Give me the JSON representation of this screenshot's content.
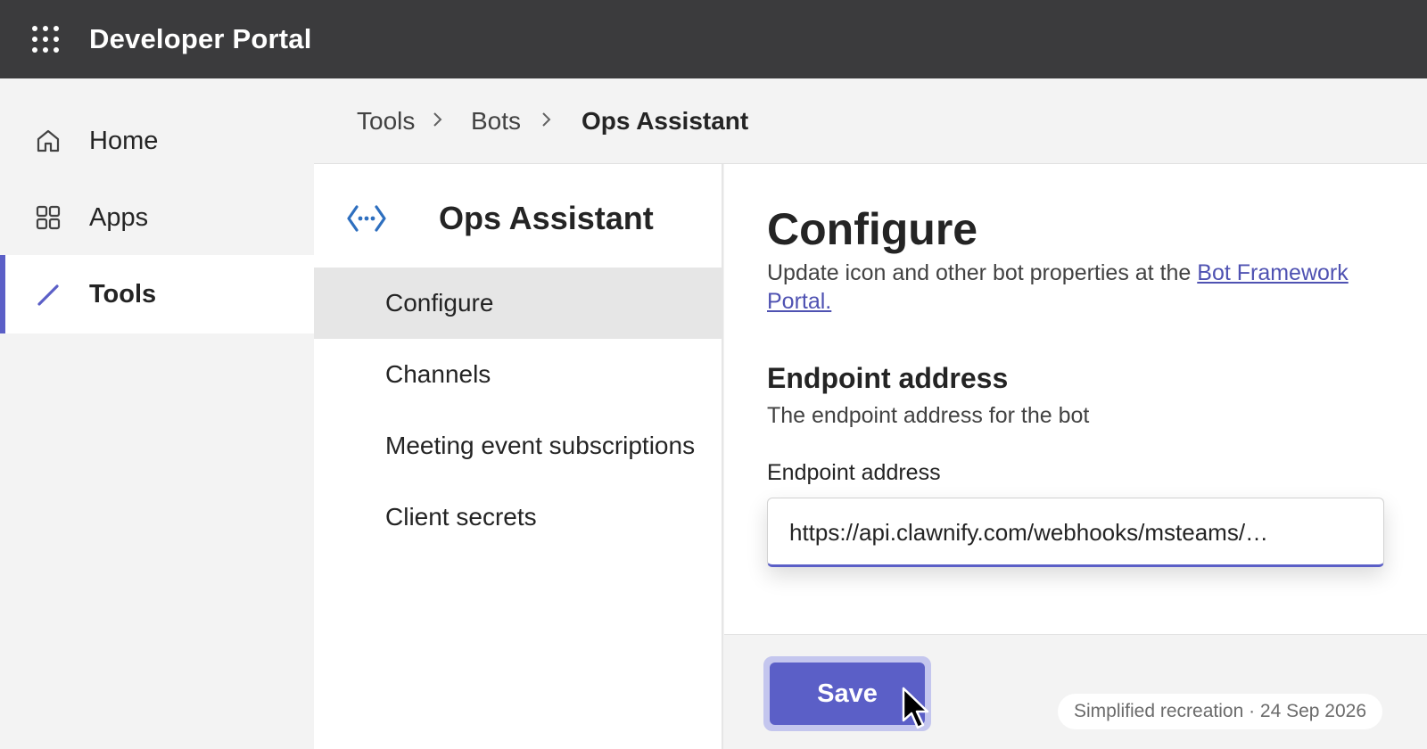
{
  "app": {
    "title": "Developer Portal",
    "launcher_icon": "app-launcher-icon"
  },
  "left_nav": {
    "items": [
      {
        "label": "Home",
        "icon": "home-icon",
        "active": false
      },
      {
        "label": "Apps",
        "icon": "apps-grid-icon",
        "active": false
      },
      {
        "label": "Tools",
        "icon": "pencil-icon",
        "active": true
      }
    ]
  },
  "breadcrumb": {
    "items": [
      "Tools",
      "Bots",
      "Ops Assistant"
    ],
    "separator_icon": "chevron-right-icon"
  },
  "bot": {
    "name": "Ops Assistant",
    "icon": "bot-code-icon"
  },
  "sub_nav": {
    "items": [
      {
        "label": "Configure",
        "active": true
      },
      {
        "label": "Channels",
        "active": false
      },
      {
        "label": "Meeting event subscriptions",
        "active": false
      },
      {
        "label": "Client secrets",
        "active": false
      }
    ]
  },
  "configure": {
    "title": "Configure",
    "description_prefix": "Update icon and other bot properties at the ",
    "description_link": "Bot Framework Portal.",
    "section_title": "Endpoint address",
    "section_description": "The endpoint address for the bot",
    "field_label": "Endpoint address",
    "field_value": "https://api.clawnify.com/webhooks/msteams/…"
  },
  "footer": {
    "save_label": "Save",
    "note": "Simplified recreation · 24 Sep 2026"
  },
  "colors": {
    "accent": "#5b5fc7",
    "topbar": "#3b3b3d",
    "link": "#4f52b2"
  }
}
